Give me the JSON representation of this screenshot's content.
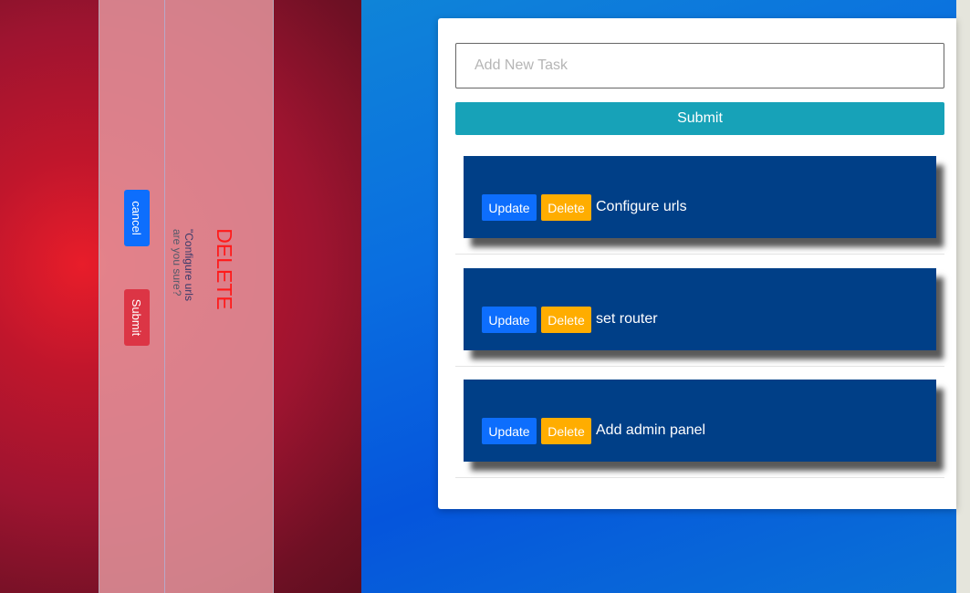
{
  "modal": {
    "title": "DELETE",
    "message_line1": "\"Configure urls",
    "message_line2": "are you sure?",
    "cancel_label": "cancel",
    "submit_label": "Submit"
  },
  "form": {
    "placeholder": "Add New Task",
    "value": "",
    "submit_label": "Submit"
  },
  "tasks": [
    {
      "update_label": "Update",
      "delete_label": "Delete",
      "text": "Configure urls"
    },
    {
      "update_label": "Update",
      "delete_label": "Delete",
      "text": "set router"
    },
    {
      "update_label": "Update",
      "delete_label": "Delete",
      "text": "Add admin panel"
    }
  ],
  "colors": {
    "left_background": "#9e1430",
    "right_background": "#0a6ee0",
    "task_card": "#003f87",
    "update_button": "#0d6efd",
    "delete_button": "#ffad00",
    "submit_button": "#17a2b8",
    "modal_title": "#ff1a1a",
    "modal_submit": "#dc3545"
  }
}
